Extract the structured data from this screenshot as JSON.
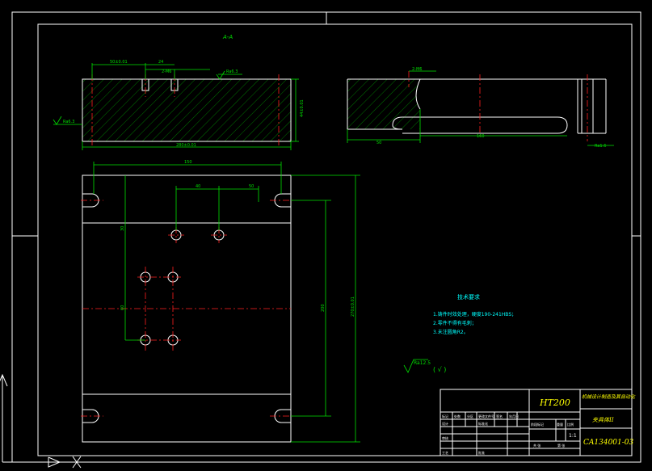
{
  "section_label": "A-A",
  "dims": {
    "top_left": "50±0.01",
    "top_gap": "24",
    "top_holes": "2-M6",
    "top_ra": "Ra6.3",
    "left_ra": "Ra6.3",
    "right_h": "44±0.01",
    "overall_w": "280±0.01",
    "side_holes": "2-M6",
    "side_ra": "Ra1.6",
    "side_50": "50",
    "side_160": "160",
    "side_bottom": "Ra1.6",
    "plan_w": "150",
    "plan_40": "40",
    "plan_50": "50",
    "plan_30": "30",
    "plan_60": "60",
    "plan_200": "200",
    "plan_overall_h": "270±0.01"
  },
  "notes": {
    "title": "技术要求",
    "items": [
      "1.铸件时效处理，硬度190-241HBS；",
      "2.零件不得有毛刺；",
      "3.未注圆角R2。"
    ]
  },
  "roughness": "Ra12.5",
  "title_block": {
    "material": "HT200",
    "project": "机械设计制造及其自动化",
    "drawing_name": "夹具体II",
    "drawing_no": "CA134001-03",
    "scale": "1:1",
    "labels": {
      "mark": "标记",
      "count": "处数",
      "zone": "分区",
      "change_doc": "更改文件号",
      "sign": "签名",
      "date": "年月日",
      "design": "设计",
      "standard": "标准化",
      "stage": "阶段标记",
      "weight": "重量",
      "ratio": "比例",
      "review": "审核",
      "process": "工艺",
      "approve": "批准",
      "sheets": "共  张",
      "sheet": "第  张"
    }
  }
}
